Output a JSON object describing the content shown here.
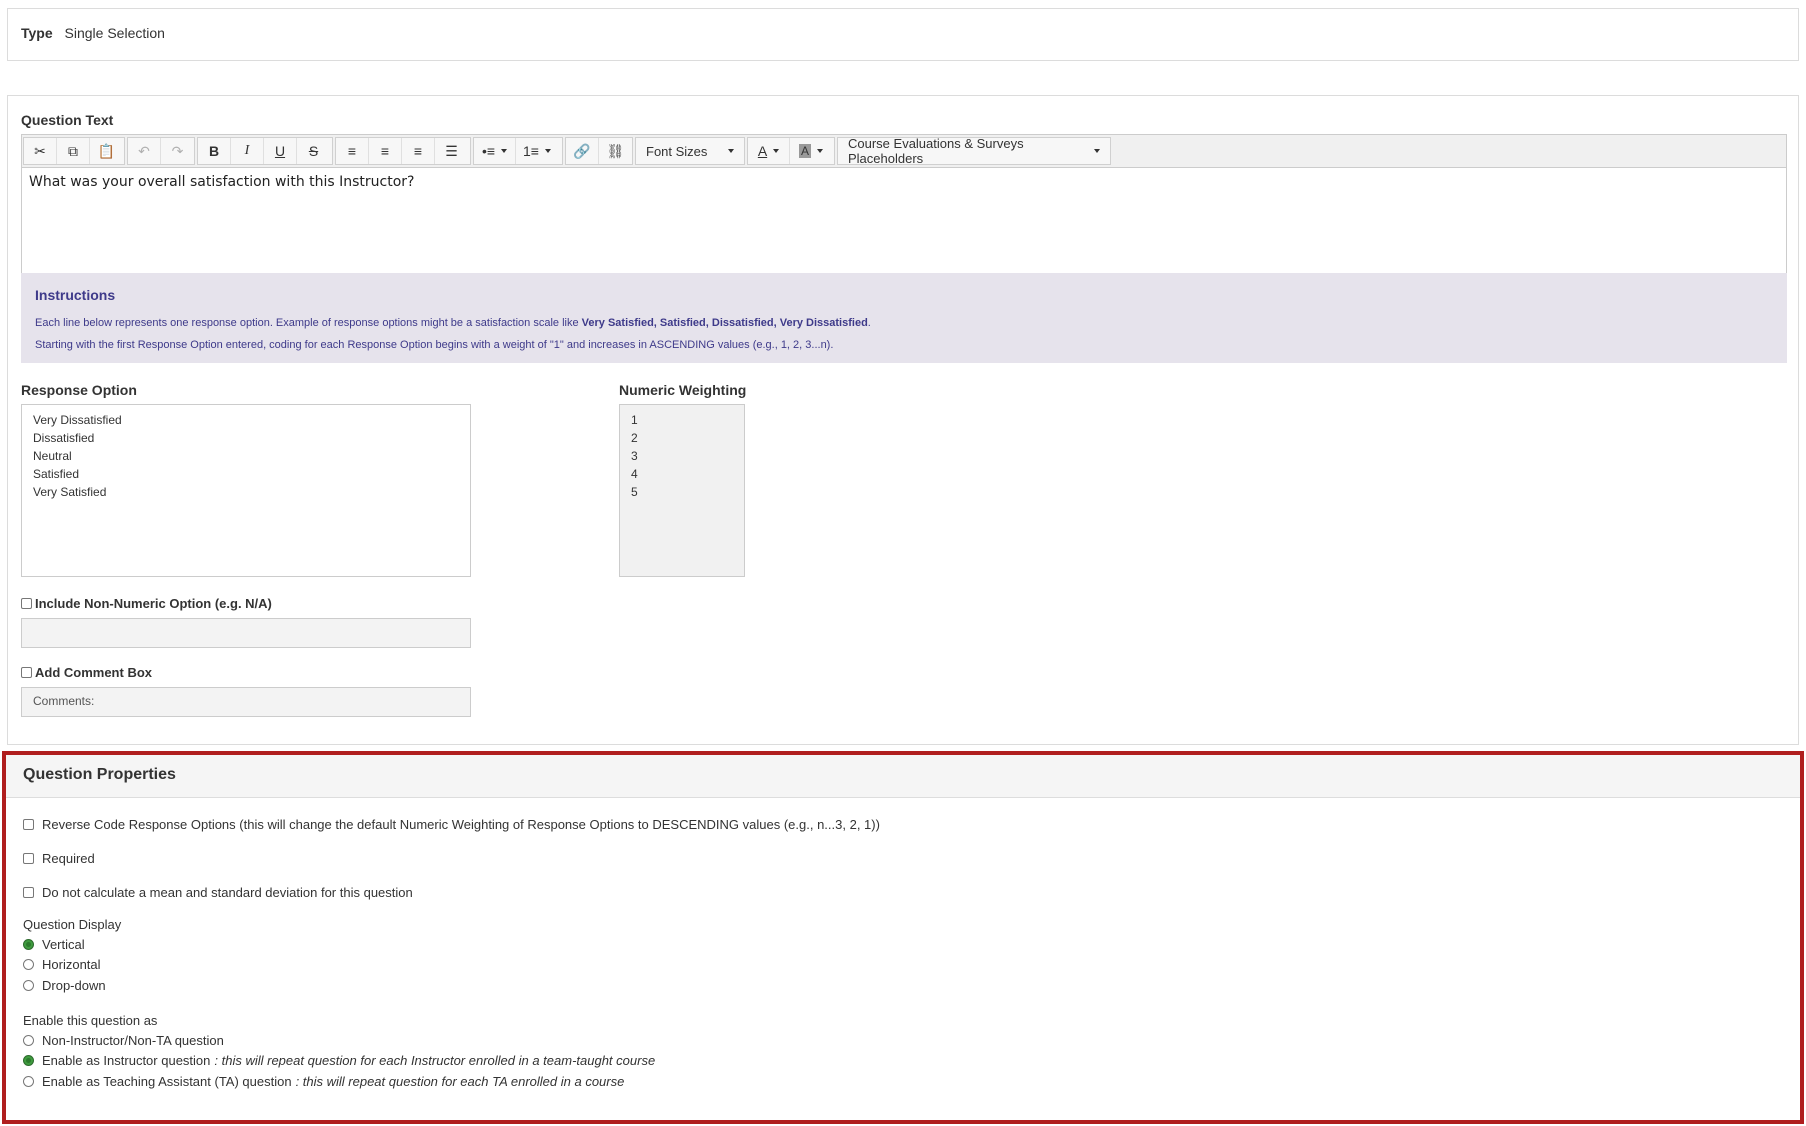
{
  "type_row": {
    "label": "Type",
    "value": "Single Selection"
  },
  "question_text": {
    "label": "Question Text",
    "content": "What was your overall satisfaction with this Instructor?",
    "toolbar": {
      "font_sizes_label": "Font Sizes",
      "placeholders_label": "Course Evaluations & Surveys Placeholders"
    }
  },
  "instructions": {
    "title": "Instructions",
    "line1_prefix": "Each line below represents one response option. Example of response options might be a satisfaction scale like ",
    "line1_bold": "Very Satisfied, Satisfied, Dissatisfied, Very Dissatisfied",
    "line1_suffix": ".",
    "line2": "Starting with the first Response Option entered, coding for each Response Option begins with a weight of \"1\" and increases in ASCENDING values (e.g., 1, 2, 3...n)."
  },
  "response_option": {
    "label": "Response Option",
    "items": [
      "Very Dissatisfied",
      "Dissatisfied",
      "Neutral",
      "Satisfied",
      "Very Satisfied"
    ]
  },
  "numeric_weighting": {
    "label": "Numeric Weighting",
    "items": [
      "1",
      "2",
      "3",
      "4",
      "5"
    ]
  },
  "non_numeric": {
    "label": "Include Non-Numeric Option (e.g. N/A)",
    "value": ""
  },
  "comment_box": {
    "label": "Add Comment Box",
    "value": "Comments:"
  },
  "properties": {
    "title": "Question Properties",
    "reverse_code": "Reverse Code Response Options (this will change the default Numeric Weighting of Response Options to DESCENDING values (e.g., n...3, 2, 1))",
    "required": "Required",
    "no_mean": "Do not calculate a mean and standard deviation for this question",
    "display_label": "Question Display",
    "display_options": [
      "Vertical",
      "Horizontal",
      "Drop-down"
    ],
    "display_selected": "Vertical",
    "enable_label": "Enable this question as",
    "enable_options": [
      {
        "label": "Non-Instructor/Non-TA question",
        "note": ""
      },
      {
        "label": "Enable as Instructor question",
        "note": ": this will repeat question for each Instructor enrolled in a team-taught course"
      },
      {
        "label": "Enable as Teaching Assistant (TA) question",
        "note": ": this will repeat question for each TA enrolled in a course"
      }
    ],
    "enable_selected": "Enable as Instructor question"
  }
}
